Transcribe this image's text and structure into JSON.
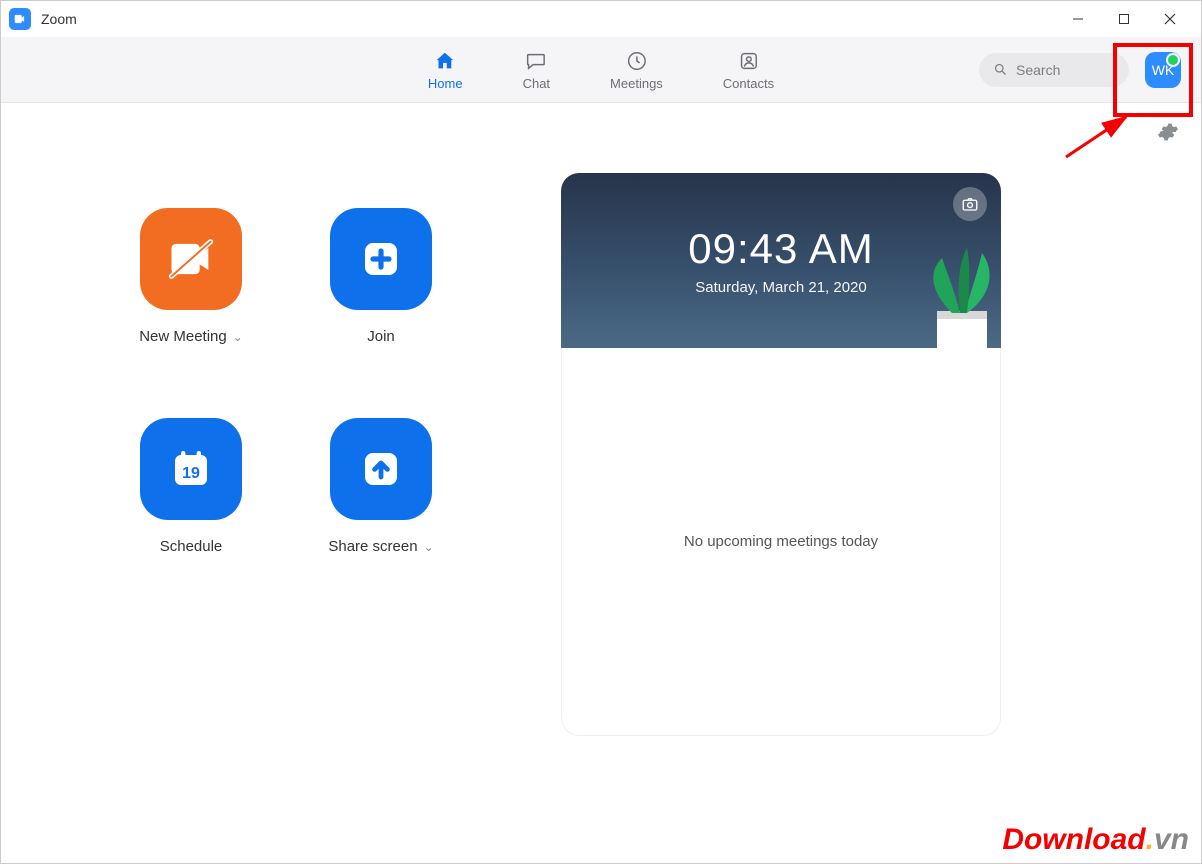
{
  "window": {
    "title": "Zoom"
  },
  "nav": {
    "tabs": {
      "home": "Home",
      "chat": "Chat",
      "meetings": "Meetings",
      "contacts": "Contacts"
    },
    "search_placeholder": "Search",
    "avatar_initials": "WK"
  },
  "actions": {
    "new_meeting": "New Meeting",
    "join": "Join",
    "schedule": "Schedule",
    "schedule_day": "19",
    "share_screen": "Share screen"
  },
  "clock": {
    "time": "09:43 AM",
    "date": "Saturday, March 21, 2020"
  },
  "upcoming": {
    "empty": "No upcoming meetings today"
  },
  "watermark": {
    "text1": "Download",
    "dot": ".",
    "text2": "vn"
  }
}
